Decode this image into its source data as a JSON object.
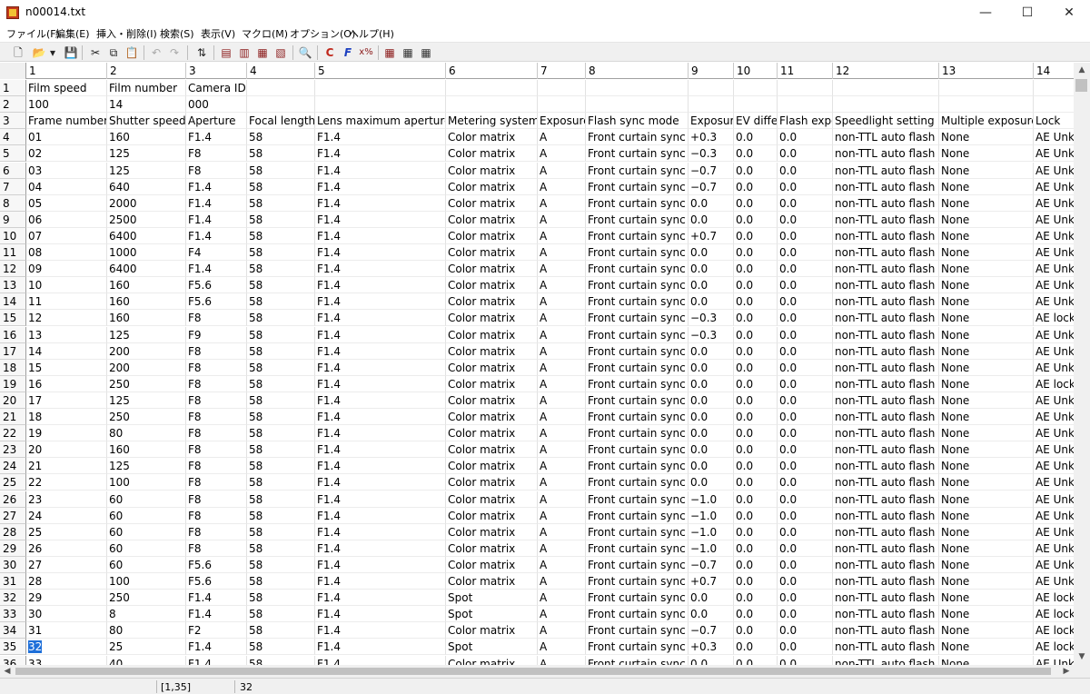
{
  "window": {
    "title": "n00014.txt",
    "minimize": "—",
    "maximize": "☐",
    "close": "✕"
  },
  "menu": [
    "ファイル(F)",
    "編集(E)",
    "挿入・削除(I)",
    "検索(S)",
    "表示(V)",
    "マクロ(M)",
    "オプション(O)",
    "ヘルプ(H)"
  ],
  "toolbar_icons": [
    "new-file",
    "open-folder",
    "dropdown-arrow",
    "save",
    "cut",
    "copy",
    "paste",
    "undo",
    "redo",
    "sort",
    "insert-row",
    "insert-column",
    "delete-row",
    "delete-column",
    "find",
    "mark",
    "format",
    "calc",
    "view-grid-1",
    "view-grid-2",
    "view-grid-3"
  ],
  "toolbar_glyphs": [
    "🗋",
    "📂",
    "▾",
    "💾",
    "✂",
    "⧉",
    "📋",
    "↶",
    "↷",
    "⇅",
    "▤",
    "▥",
    "▦",
    "▧",
    "🔍",
    "C",
    "F",
    "x%",
    "▦",
    "▦",
    "▦"
  ],
  "column_headers": [
    "1",
    "2",
    "3",
    "4",
    "5",
    "6",
    "7",
    "8",
    "9",
    "10",
    "11",
    "12",
    "13",
    "14"
  ],
  "rows": [
    [
      "Film speed",
      "Film number",
      "Camera ID",
      "",
      "",
      "",
      "",
      "",
      "",
      "",
      "",
      "",
      "",
      ""
    ],
    [
      "100",
      "14",
      "000",
      "",
      "",
      "",
      "",
      "",
      "",
      "",
      "",
      "",
      "",
      ""
    ],
    [
      "Frame number",
      "Shutter speed",
      "Aperture",
      "Focal length",
      "Lens maximum aperture",
      "Metering system",
      "Exposure",
      "Flash sync mode",
      "Exposure",
      "EV diffe",
      "Flash expo",
      "Speedlight setting",
      "Multiple exposure",
      "Lock"
    ],
    [
      "01",
      "160",
      "F1.4",
      "58",
      "F1.4",
      "Color matrix",
      "A",
      "Front curtain sync",
      "+0.3",
      "0.0",
      "0.0",
      "non-TTL auto flash",
      "None",
      "AE Unk"
    ],
    [
      "02",
      "125",
      "F8",
      "58",
      "F1.4",
      "Color matrix",
      "A",
      "Front curtain sync",
      "−0.3",
      "0.0",
      "0.0",
      "non-TTL auto flash",
      "None",
      "AE Unk"
    ],
    [
      "03",
      "125",
      "F8",
      "58",
      "F1.4",
      "Color matrix",
      "A",
      "Front curtain sync",
      "−0.7",
      "0.0",
      "0.0",
      "non-TTL auto flash",
      "None",
      "AE Unk"
    ],
    [
      "04",
      "640",
      "F1.4",
      "58",
      "F1.4",
      "Color matrix",
      "A",
      "Front curtain sync",
      "−0.7",
      "0.0",
      "0.0",
      "non-TTL auto flash",
      "None",
      "AE Unk"
    ],
    [
      "05",
      "2000",
      "F1.4",
      "58",
      "F1.4",
      "Color matrix",
      "A",
      "Front curtain sync",
      "0.0",
      "0.0",
      "0.0",
      "non-TTL auto flash",
      "None",
      "AE Unk"
    ],
    [
      "06",
      "2500",
      "F1.4",
      "58",
      "F1.4",
      "Color matrix",
      "A",
      "Front curtain sync",
      "0.0",
      "0.0",
      "0.0",
      "non-TTL auto flash",
      "None",
      "AE Unk"
    ],
    [
      "07",
      "6400",
      "F1.4",
      "58",
      "F1.4",
      "Color matrix",
      "A",
      "Front curtain sync",
      "+0.7",
      "0.0",
      "0.0",
      "non-TTL auto flash",
      "None",
      "AE Unk"
    ],
    [
      "08",
      "1000",
      "F4",
      "58",
      "F1.4",
      "Color matrix",
      "A",
      "Front curtain sync",
      "0.0",
      "0.0",
      "0.0",
      "non-TTL auto flash",
      "None",
      "AE Unk"
    ],
    [
      "09",
      "6400",
      "F1.4",
      "58",
      "F1.4",
      "Color matrix",
      "A",
      "Front curtain sync",
      "0.0",
      "0.0",
      "0.0",
      "non-TTL auto flash",
      "None",
      "AE Unk"
    ],
    [
      "10",
      "160",
      "F5.6",
      "58",
      "F1.4",
      "Color matrix",
      "A",
      "Front curtain sync",
      "0.0",
      "0.0",
      "0.0",
      "non-TTL auto flash",
      "None",
      "AE Unk"
    ],
    [
      "11",
      "160",
      "F5.6",
      "58",
      "F1.4",
      "Color matrix",
      "A",
      "Front curtain sync",
      "0.0",
      "0.0",
      "0.0",
      "non-TTL auto flash",
      "None",
      "AE Unk"
    ],
    [
      "12",
      "160",
      "F8",
      "58",
      "F1.4",
      "Color matrix",
      "A",
      "Front curtain sync",
      "−0.3",
      "0.0",
      "0.0",
      "non-TTL auto flash",
      "None",
      "AE lock"
    ],
    [
      "13",
      "125",
      "F9",
      "58",
      "F1.4",
      "Color matrix",
      "A",
      "Front curtain sync",
      "−0.3",
      "0.0",
      "0.0",
      "non-TTL auto flash",
      "None",
      "AE Unk"
    ],
    [
      "14",
      "200",
      "F8",
      "58",
      "F1.4",
      "Color matrix",
      "A",
      "Front curtain sync",
      "0.0",
      "0.0",
      "0.0",
      "non-TTL auto flash",
      "None",
      "AE Unk"
    ],
    [
      "15",
      "200",
      "F8",
      "58",
      "F1.4",
      "Color matrix",
      "A",
      "Front curtain sync",
      "0.0",
      "0.0",
      "0.0",
      "non-TTL auto flash",
      "None",
      "AE Unk"
    ],
    [
      "16",
      "250",
      "F8",
      "58",
      "F1.4",
      "Color matrix",
      "A",
      "Front curtain sync",
      "0.0",
      "0.0",
      "0.0",
      "non-TTL auto flash",
      "None",
      "AE lock"
    ],
    [
      "17",
      "125",
      "F8",
      "58",
      "F1.4",
      "Color matrix",
      "A",
      "Front curtain sync",
      "0.0",
      "0.0",
      "0.0",
      "non-TTL auto flash",
      "None",
      "AE Unk"
    ],
    [
      "18",
      "250",
      "F8",
      "58",
      "F1.4",
      "Color matrix",
      "A",
      "Front curtain sync",
      "0.0",
      "0.0",
      "0.0",
      "non-TTL auto flash",
      "None",
      "AE Unk"
    ],
    [
      "19",
      "80",
      "F8",
      "58",
      "F1.4",
      "Color matrix",
      "A",
      "Front curtain sync",
      "0.0",
      "0.0",
      "0.0",
      "non-TTL auto flash",
      "None",
      "AE Unk"
    ],
    [
      "20",
      "160",
      "F8",
      "58",
      "F1.4",
      "Color matrix",
      "A",
      "Front curtain sync",
      "0.0",
      "0.0",
      "0.0",
      "non-TTL auto flash",
      "None",
      "AE Unk"
    ],
    [
      "21",
      "125",
      "F8",
      "58",
      "F1.4",
      "Color matrix",
      "A",
      "Front curtain sync",
      "0.0",
      "0.0",
      "0.0",
      "non-TTL auto flash",
      "None",
      "AE Unk"
    ],
    [
      "22",
      "100",
      "F8",
      "58",
      "F1.4",
      "Color matrix",
      "A",
      "Front curtain sync",
      "0.0",
      "0.0",
      "0.0",
      "non-TTL auto flash",
      "None",
      "AE Unk"
    ],
    [
      "23",
      "60",
      "F8",
      "58",
      "F1.4",
      "Color matrix",
      "A",
      "Front curtain sync",
      "−1.0",
      "0.0",
      "0.0",
      "non-TTL auto flash",
      "None",
      "AE Unk"
    ],
    [
      "24",
      "60",
      "F8",
      "58",
      "F1.4",
      "Color matrix",
      "A",
      "Front curtain sync",
      "−1.0",
      "0.0",
      "0.0",
      "non-TTL auto flash",
      "None",
      "AE Unk"
    ],
    [
      "25",
      "60",
      "F8",
      "58",
      "F1.4",
      "Color matrix",
      "A",
      "Front curtain sync",
      "−1.0",
      "0.0",
      "0.0",
      "non-TTL auto flash",
      "None",
      "AE Unk"
    ],
    [
      "26",
      "60",
      "F8",
      "58",
      "F1.4",
      "Color matrix",
      "A",
      "Front curtain sync",
      "−1.0",
      "0.0",
      "0.0",
      "non-TTL auto flash",
      "None",
      "AE Unk"
    ],
    [
      "27",
      "60",
      "F5.6",
      "58",
      "F1.4",
      "Color matrix",
      "A",
      "Front curtain sync",
      "−0.7",
      "0.0",
      "0.0",
      "non-TTL auto flash",
      "None",
      "AE Unk"
    ],
    [
      "28",
      "100",
      "F5.6",
      "58",
      "F1.4",
      "Color matrix",
      "A",
      "Front curtain sync",
      "+0.7",
      "0.0",
      "0.0",
      "non-TTL auto flash",
      "None",
      "AE Unk"
    ],
    [
      "29",
      "250",
      "F1.4",
      "58",
      "F1.4",
      "Spot",
      "A",
      "Front curtain sync",
      "0.0",
      "0.0",
      "0.0",
      "non-TTL auto flash",
      "None",
      "AE lock"
    ],
    [
      "30",
      "8",
      "F1.4",
      "58",
      "F1.4",
      "Spot",
      "A",
      "Front curtain sync",
      "0.0",
      "0.0",
      "0.0",
      "non-TTL auto flash",
      "None",
      "AE lock"
    ],
    [
      "31",
      "80",
      "F2",
      "58",
      "F1.4",
      "Color matrix",
      "A",
      "Front curtain sync",
      "−0.7",
      "0.0",
      "0.0",
      "non-TTL auto flash",
      "None",
      "AE lock"
    ],
    [
      "32",
      "25",
      "F1.4",
      "58",
      "F1.4",
      "Spot",
      "A",
      "Front curtain sync",
      "+0.3",
      "0.0",
      "0.0",
      "non-TTL auto flash",
      "None",
      "AE lock"
    ],
    [
      "33",
      "40",
      "F1.4",
      "58",
      "F1.4",
      "Color matrix",
      "A",
      "Front curtain sync",
      "0.0",
      "0.0",
      "0.0",
      "non-TTL auto flash",
      "None",
      "AE Unk"
    ]
  ],
  "selected_cell": {
    "row": 35,
    "col": 1
  },
  "status": {
    "position": "[1,35]",
    "value": "32"
  },
  "colors": {
    "selection": "#1e6fd9",
    "chrome": "#f0f0f0",
    "gridline": "#e2e2e2"
  }
}
